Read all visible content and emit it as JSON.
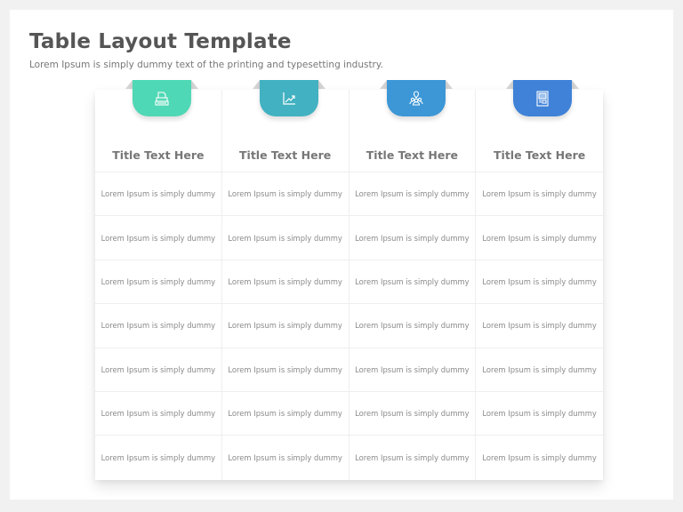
{
  "header": {
    "title": "Table Layout Template",
    "subtitle": "Lorem Ipsum is simply dummy text of the printing and typesetting industry."
  },
  "columns": [
    {
      "title": "Title Text Here",
      "icon": "typewriter-icon",
      "color": "#4fd8b5",
      "cells": [
        "Lorem Ipsum is simply dummy",
        "Lorem Ipsum is simply dummy",
        "Lorem Ipsum is simply dummy",
        "Lorem Ipsum is simply dummy",
        "Lorem Ipsum is simply dummy",
        "Lorem Ipsum is simply dummy",
        "Lorem Ipsum is simply dummy"
      ]
    },
    {
      "title": "Title Text Here",
      "icon": "growth-chart-icon",
      "color": "#42b1c1",
      "cells": [
        "Lorem Ipsum is simply dummy",
        "Lorem Ipsum is simply dummy",
        "Lorem Ipsum is simply dummy",
        "Lorem Ipsum is simply dummy",
        "Lorem Ipsum is simply dummy",
        "Lorem Ipsum is simply dummy",
        "Lorem Ipsum is simply dummy"
      ]
    },
    {
      "title": "Title Text Here",
      "icon": "location-team-icon",
      "color": "#3d97d6",
      "cells": [
        "Lorem Ipsum is simply dummy",
        "Lorem Ipsum is simply dummy",
        "Lorem Ipsum is simply dummy",
        "Lorem Ipsum is simply dummy",
        "Lorem Ipsum is simply dummy",
        "Lorem Ipsum is simply dummy",
        "Lorem Ipsum is simply dummy"
      ]
    },
    {
      "title": "Title Text Here",
      "icon": "document-layout-icon",
      "color": "#3f82d8",
      "cells": [
        "Lorem Ipsum is simply dummy",
        "Lorem Ipsum is simply dummy",
        "Lorem Ipsum is simply dummy",
        "Lorem Ipsum is simply dummy",
        "Lorem Ipsum is simply dummy",
        "Lorem Ipsum is simply dummy",
        "Lorem Ipsum is simply dummy"
      ]
    }
  ]
}
